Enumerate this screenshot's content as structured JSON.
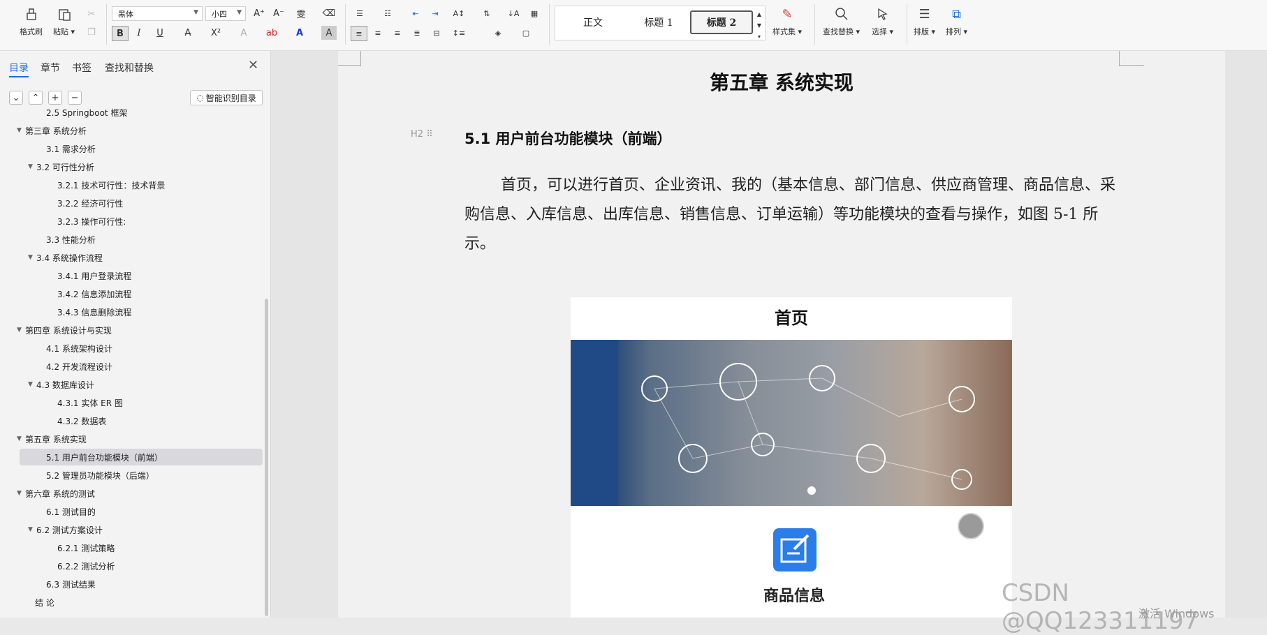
{
  "ribbon": {
    "format_painter": "格式刷",
    "paste": "粘贴",
    "font_name": "黑体",
    "font_size": "小四",
    "styles": [
      "正文",
      "标题 1",
      "标题 2"
    ],
    "style_set": "样式集",
    "find_replace": "查找替换",
    "select": "选择",
    "layout": "排版",
    "arrange": "排列"
  },
  "nav": {
    "tabs": [
      "目录",
      "章节",
      "书签",
      "查找和替换"
    ],
    "smart_toc": "智能识别目录",
    "toc": [
      {
        "label": "2.5 Springboot 框架",
        "level": 2
      },
      {
        "label": "第三章 系统分析",
        "level": 1
      },
      {
        "label": "3.1 需求分析",
        "level": 2
      },
      {
        "label": "3.2 可行性分析",
        "level": 2
      },
      {
        "label": "3.2.1 技术可行性：技术背景",
        "level": 3
      },
      {
        "label": "3.2.2 经济可行性",
        "level": 3
      },
      {
        "label": "3.2.3 操作可行性:",
        "level": 3
      },
      {
        "label": "3.3 性能分析",
        "level": 2
      },
      {
        "label": "3.4 系统操作流程",
        "level": 2
      },
      {
        "label": "3.4.1 用户登录流程",
        "level": 3
      },
      {
        "label": "3.4.2 信息添加流程",
        "level": 3
      },
      {
        "label": "3.4.3 信息删除流程",
        "level": 3
      },
      {
        "label": "第四章 系统设计与实现",
        "level": 1
      },
      {
        "label": "4.1 系统架构设计",
        "level": 2
      },
      {
        "label": "4.2 开发流程设计",
        "level": 2
      },
      {
        "label": "4.3 数据库设计",
        "level": 2
      },
      {
        "label": "4.3.1 实体 ER 图",
        "level": 3
      },
      {
        "label": "4.3.2 数据表",
        "level": 3
      },
      {
        "label": "第五章 系统实现",
        "level": 1
      },
      {
        "label": "5.1 用户前台功能模块（前端）",
        "level": 2
      },
      {
        "label": "5.2 管理员功能模块（后端）",
        "level": 2
      },
      {
        "label": "第六章   系统的测试",
        "level": 1
      },
      {
        "label": "6.1  测试目的",
        "level": 2
      },
      {
        "label": "6.2  测试方案设计",
        "level": 2
      },
      {
        "label": "6.2.1  测试策略",
        "level": 3
      },
      {
        "label": "6.2.2  测试分析",
        "level": 3
      },
      {
        "label": "6.3  测试结果",
        "level": 2
      },
      {
        "label": "结  论",
        "level": 1
      }
    ],
    "selected_index": 19
  },
  "doc": {
    "chapter_title": "第五章  系统实现",
    "heading2_marker": "H2",
    "section_title": "5.1 用户前台功能模块（前端）",
    "paragraph": "首页，可以进行首页、企业资讯、我的（基本信息、部门信息、供应商管理、商品信息、采购信息、入库信息、出库信息、销售信息、订单运输）等功能模块的查看与操作，如图 5-1 所示。",
    "figure_title": "首页",
    "figure_item_label": "商品信息"
  },
  "overlay": {
    "watermark": "CSDN @QQ123311197",
    "activate_windows": "激活 Windows"
  },
  "colors": {
    "accent": "#1a6de0",
    "figure_icon": "#2b7de9"
  }
}
